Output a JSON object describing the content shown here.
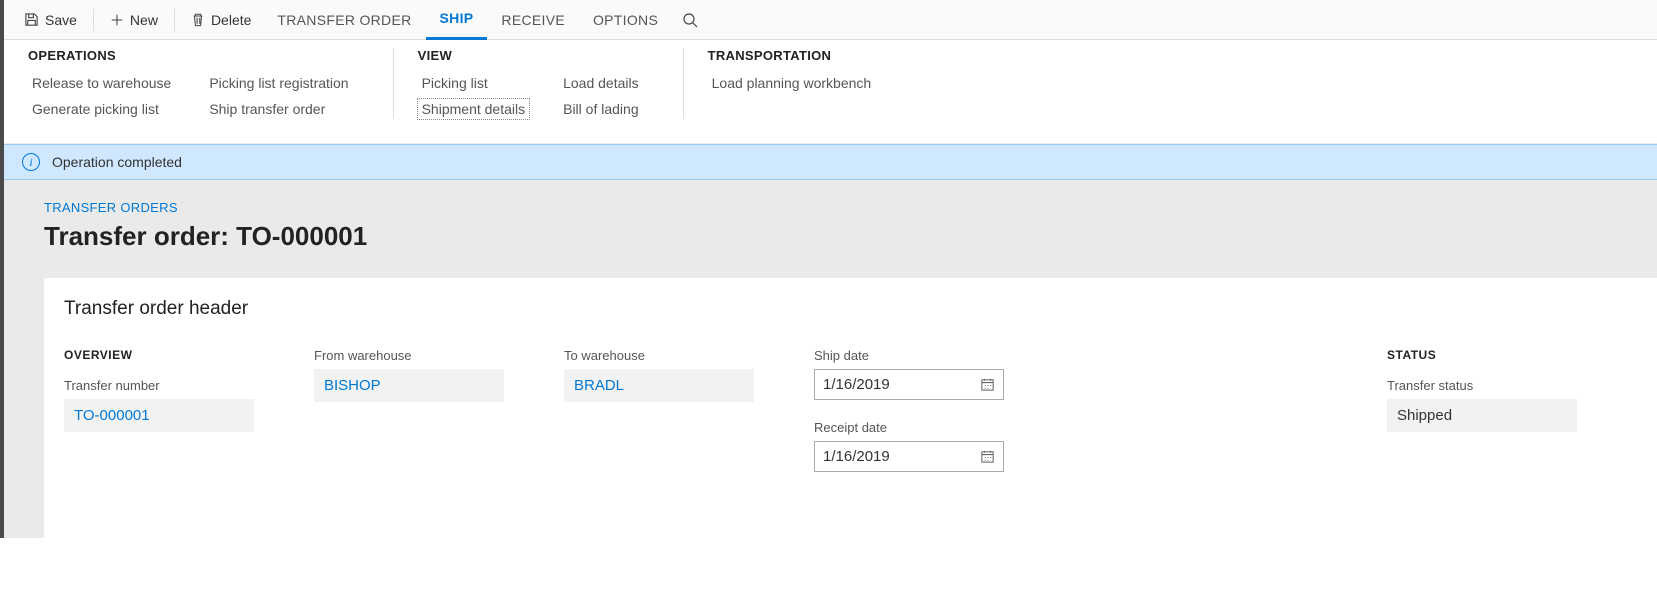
{
  "toolbar": {
    "save_label": "Save",
    "new_label": "New",
    "delete_label": "Delete",
    "tabs": [
      "TRANSFER ORDER",
      "SHIP",
      "RECEIVE",
      "OPTIONS"
    ],
    "active_tab": 1
  },
  "ribbon": {
    "groups": [
      {
        "title": "OPERATIONS",
        "cols": [
          [
            "Release to warehouse",
            "Generate picking list"
          ],
          [
            "Picking list registration",
            "Ship transfer order"
          ]
        ]
      },
      {
        "title": "VIEW",
        "cols": [
          [
            "Picking list",
            "Shipment details"
          ],
          [
            "Load details",
            "Bill of lading"
          ]
        ],
        "focused": "Shipment details"
      },
      {
        "title": "TRANSPORTATION",
        "cols": [
          [
            "Load planning workbench"
          ]
        ]
      }
    ]
  },
  "notice": {
    "message": "Operation completed"
  },
  "page": {
    "breadcrumb": "TRANSFER ORDERS",
    "title": "Transfer order: TO-000001",
    "card_title": "Transfer order header"
  },
  "overview": {
    "section": "OVERVIEW",
    "transfer_number_label": "Transfer number",
    "transfer_number": "TO-000001",
    "from_wh_label": "From warehouse",
    "from_wh": "BISHOP",
    "to_wh_label": "To warehouse",
    "to_wh": "BRADL",
    "ship_date_label": "Ship date",
    "ship_date": "1/16/2019",
    "receipt_date_label": "Receipt date",
    "receipt_date": "1/16/2019"
  },
  "status": {
    "section": "STATUS",
    "transfer_status_label": "Transfer status",
    "transfer_status": "Shipped"
  }
}
